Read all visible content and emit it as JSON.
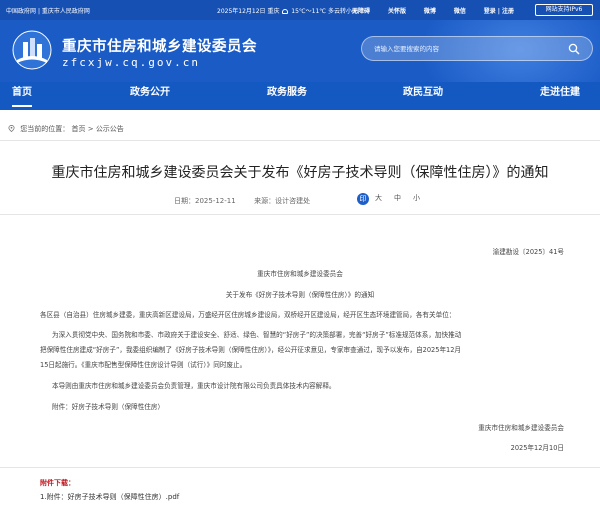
{
  "topbar": {
    "portal_links": [
      "中国政府网",
      "重庆市人民政府网"
    ],
    "separator": "|",
    "date_weather": "2025年12月12日  重庆",
    "temperature": "15℃～11℃ 多云转小雨",
    "links": [
      "无障碍",
      "关怀版",
      "微博",
      "微信",
      "登录",
      "注册"
    ],
    "ipv6": "网站支持IPv6"
  },
  "header": {
    "title": "重庆市住房和城乡建设委员会",
    "domain": "zfcxjw.cq.gov.cn",
    "search_placeholder": "请输入您要搜索的内容"
  },
  "nav": {
    "items": [
      "首页",
      "政务公开",
      "政务服务",
      "政民互动",
      "走进住建"
    ],
    "active_index": 0
  },
  "breadcrumb": {
    "prefix": "您当前的位置：",
    "items": [
      "首页",
      "公示公告"
    ],
    "sep": ">"
  },
  "article": {
    "title": "重庆市住房和城乡建设委员会关于发布《好房子技术导则（保障性住房）》的通知",
    "date_label": "日期：",
    "date": "2025-12-11",
    "source_label": "来源：",
    "source": "设计咨建处",
    "font_sizes": [
      "大",
      "中",
      "小"
    ],
    "print_label": "印",
    "doc_no": "渝建勘设〔2025〕41号",
    "issuer": "重庆市住房和城乡建设委员会",
    "subject": "关于发布《好房子技术导则（保障性住房）》的通知",
    "addressee": "各区县（自治县）住房城乡建委，重庆高新区建设局，万盛经开区住房城乡建设局，双桥经开区建设局，经开区生态环境建管局，各有关单位：",
    "paragraph1_line1": "为深入贯彻党中央、国务院和市委、市政府关于建设安全、舒适、绿色、智慧的“好房子”的决策部署，完善“好房子”标准规范体系，加快推动",
    "paragraph1_line2": "把保障性住房建成“好房子”，我委组织编制了《好房子技术导则（保障性住房）》，经公开征求意见，专家审查通过，现予以发布，自2025年12月",
    "paragraph1_line3": "15日起施行。《重庆市配售型保障性住房设计导则（试行）》同时废止。",
    "paragraph2": "本导则由重庆市住房和城乡建设委员会负责管理，重庆市设计院有限公司负责具体技术内容解释。",
    "attachment_line": "附件：好房子技术导则（保障性住房）",
    "signature": "重庆市住房和城乡建设委员会",
    "sign_date": "2025年12月10日"
  },
  "attachments": {
    "label": "附件下载：",
    "items": [
      "1.附件：好房子技术导则（保障性住房）.pdf"
    ]
  },
  "colors": {
    "brand_blue": "#1a5bc6",
    "nav_blue": "#1459c1",
    "attachment_red": "#c0141e"
  }
}
